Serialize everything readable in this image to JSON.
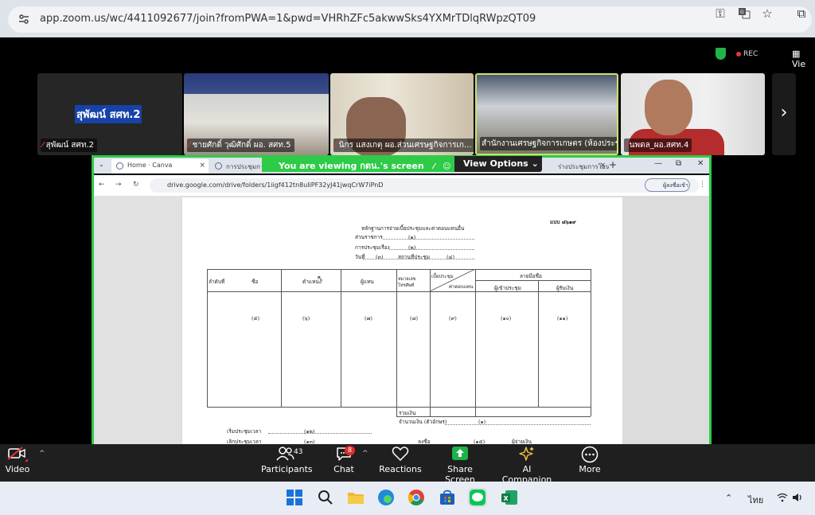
{
  "browser": {
    "url": "app.zoom.us/wc/4411092677/join?fromPWA=1&pwd=VHRhZFc5akwwSks4YXMrTDlqRWpzQT09"
  },
  "zoom_top": {
    "rec_label": "REC",
    "view_label": "Vie"
  },
  "gallery": [
    {
      "name": "สุพัฒน์ สศท.2",
      "big_name": "สุพัฒน์ สศท.2"
    },
    {
      "name": "ชายศักดิ์ วุฒิศักดิ์ ผอ. สศท.5"
    },
    {
      "name": "นิกร แสงเกตุ ผอ.ส่วนเศรษฐกิจการเก..."
    },
    {
      "name": "สำนักงานเศรษฐกิจการเกษตร (ห้องประชุ..."
    },
    {
      "name": "นพดล_ผอ.สศท.4"
    }
  ],
  "share": {
    "banner_prefix": "You are viewing",
    "banner_name": "กตน.'s screen",
    "view_options": "View Options",
    "tabs": [
      {
        "title": "Home · Canva"
      },
      {
        "title": "การประชุมการ..."
      },
      {
        "title": "ร่างประชุมการโอนเงิน..."
      }
    ],
    "inner_url": "drive.google.com/drive/folders/1iigf412tn8uliPF32yJ41jwqCrW7iPnD",
    "signin_label": "ผู้ลงชื่อเข้า"
  },
  "document": {
    "form_code": "แบบ ๘๖๑๙",
    "title": "หลักฐานการจ่ายเบี้ยประชุมและค่าตอบแทนอื่น",
    "lines": [
      {
        "label": "ส่วนราชการ",
        "num": "(๑)"
      },
      {
        "label": "การประชุมเรื่อง",
        "num": "(๒)"
      },
      {
        "label": "วันที่",
        "num": "(๓)"
      },
      {
        "label": "สถานที่ประชุม",
        "num": "(๔)"
      }
    ],
    "headers": [
      "ลำดับที่",
      "ชื่อ",
      "ตำแหน่ง",
      "ผู้แทน",
      "หมายเลขโทรศัพท์",
      "เบี้ยประชุม",
      "ค่าตอบแทน",
      "ลายมือชื่อ",
      "ผู้เข้าประชุม",
      "ผู้รับเงิน"
    ],
    "cols": [
      "(๕)",
      "(๖)",
      "(๗)",
      "(๘)",
      "(๙)",
      "(๑๐)",
      "(๑๑)"
    ],
    "total_label": "รวมเงิน",
    "total_text_label": "จำนวนเงิน (ตัวอักษร)",
    "total_text_num": "(๑)",
    "bottom": [
      {
        "label": "เริ่มประชุมเวลา",
        "num": "(๑๒)"
      },
      {
        "label": "เลิกประชุมเวลา",
        "num": "(๑๓)"
      },
      {
        "label": "ลงชื่อ",
        "num": "(๑๕)"
      },
      {
        "label": "ผู้จ่ายเงิน",
        "num": ""
      }
    ]
  },
  "toolbar": {
    "video_label": "Video",
    "participants_label": "Participants",
    "participants_count": "43",
    "chat_label": "Chat",
    "chat_badge": "8",
    "reactions_label": "Reactions",
    "share_label": "Share Screen",
    "ai_label": "AI Companion",
    "more_label": "More"
  },
  "taskbar": {
    "lang": "ไทย"
  },
  "colors": {
    "share_green": "#2dcb48",
    "toolbar_bg": "#1f1f1f",
    "rec_red": "#e5353b"
  }
}
